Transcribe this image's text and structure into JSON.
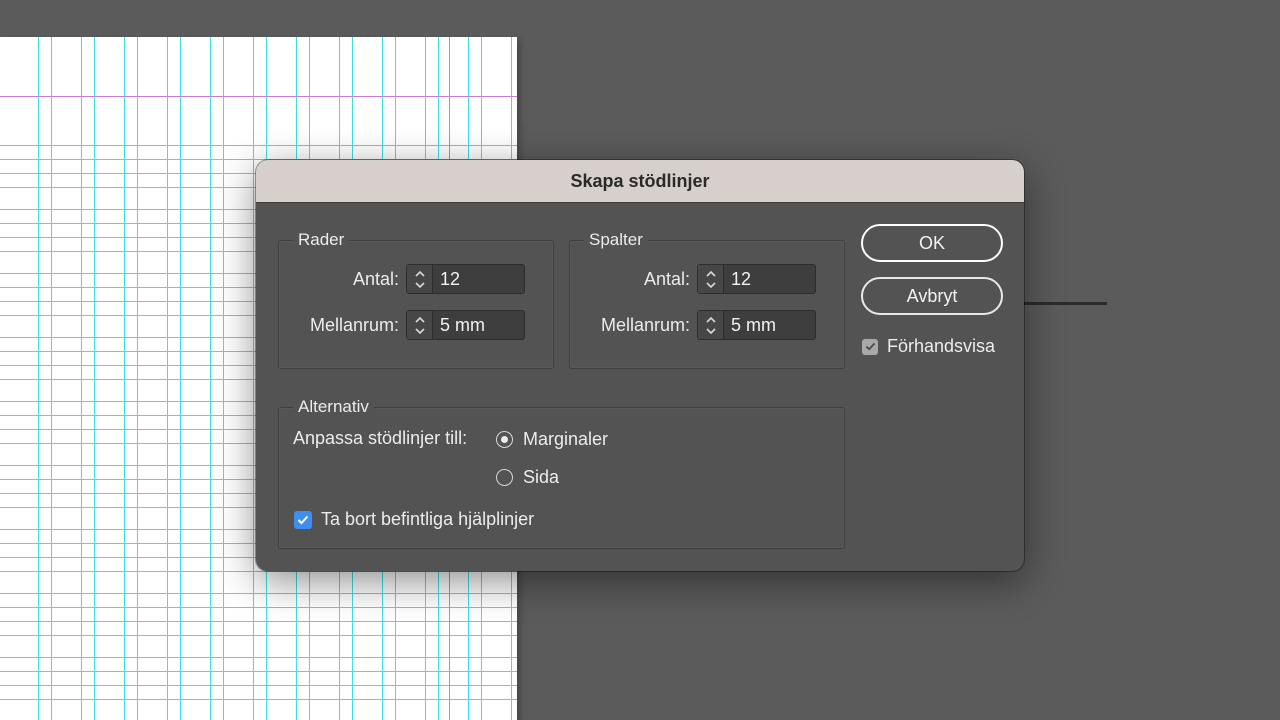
{
  "dialog": {
    "title": "Skapa stödlinjer",
    "rows": {
      "title": "Rader",
      "count_label": "Antal:",
      "count_value": "12",
      "gutter_label": "Mellanrum:",
      "gutter_value": "5 mm"
    },
    "columns": {
      "title": "Spalter",
      "count_label": "Antal:",
      "count_value": "12",
      "gutter_label": "Mellanrum:",
      "gutter_value": "5 mm"
    },
    "options": {
      "title": "Alternativ",
      "fit_label": "Anpassa stödlinjer till:",
      "radio_margins": "Marginaler",
      "radio_page": "Sida",
      "selected": "Marginaler",
      "remove_existing_label": "Ta bort befintliga hjälplinjer",
      "remove_existing_checked": true
    },
    "ok_label": "OK",
    "cancel_label": "Avbryt",
    "preview_label": "Förhandsvisa",
    "preview_checked": true
  },
  "colors": {
    "guide": "#3de0e0",
    "margin_guide": "#c77ed9",
    "checkbox_accent": "#3d8ef0",
    "pasteboard": "#5b5b5b",
    "dialog_bg": "#535353",
    "titlebar_bg": "#d6cfcb"
  }
}
